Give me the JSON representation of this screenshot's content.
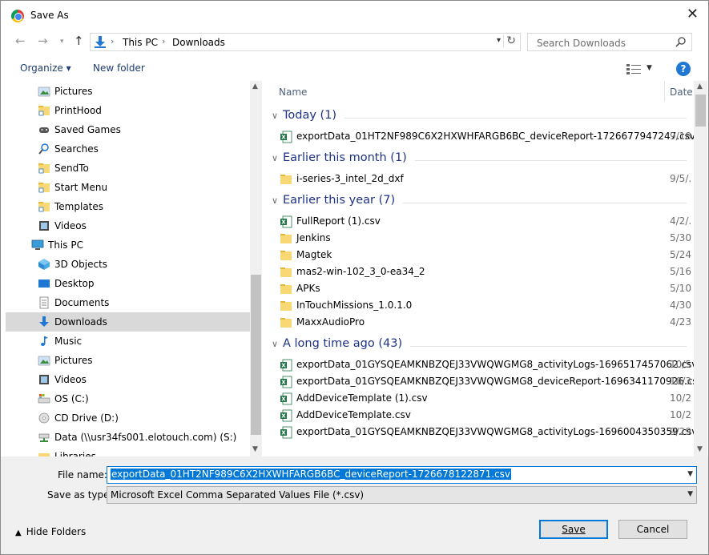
{
  "window": {
    "title": "Save As",
    "close_label": "✕"
  },
  "address": {
    "crumbs": [
      "This PC",
      "Downloads"
    ],
    "search_placeholder": "Search Downloads"
  },
  "toolbar": {
    "organize_label": "Organize ▾",
    "new_folder_label": "New folder",
    "help_label": "?"
  },
  "nav_pane": {
    "items": [
      {
        "label": "Pictures",
        "icon": "pictures-folder-icon"
      },
      {
        "label": "PrintHood",
        "icon": "shortcut-folder-icon"
      },
      {
        "label": "Saved Games",
        "icon": "saved-games-icon"
      },
      {
        "label": "Searches",
        "icon": "searches-icon"
      },
      {
        "label": "SendTo",
        "icon": "shortcut-folder-icon"
      },
      {
        "label": "Start Menu",
        "icon": "shortcut-folder-icon"
      },
      {
        "label": "Templates",
        "icon": "shortcut-folder-icon"
      },
      {
        "label": "Videos",
        "icon": "videos-folder-icon"
      },
      {
        "label": "This PC",
        "icon": "this-pc-icon"
      },
      {
        "label": "3D Objects",
        "icon": "3d-objects-icon"
      },
      {
        "label": "Desktop",
        "icon": "desktop-icon"
      },
      {
        "label": "Documents",
        "icon": "documents-icon"
      },
      {
        "label": "Downloads",
        "icon": "downloads-icon",
        "selected": true
      },
      {
        "label": "Music",
        "icon": "music-icon"
      },
      {
        "label": "Pictures",
        "icon": "pictures-folder-icon"
      },
      {
        "label": "Videos",
        "icon": "videos-folder-icon"
      },
      {
        "label": "OS (C:)",
        "icon": "os-drive-icon"
      },
      {
        "label": "CD Drive (D:)",
        "icon": "cd-drive-icon"
      },
      {
        "label": "Data (\\\\usr34fs001.elotouch.com) (S:)",
        "icon": "network-drive-icon"
      },
      {
        "label": "Libraries",
        "icon": "libraries-icon"
      }
    ]
  },
  "file_pane": {
    "columns": {
      "name": "Name",
      "date": "Date"
    },
    "groups": [
      {
        "title": "Today (1)",
        "files": [
          {
            "name": "exportData_01HT2NF989C6X2HXWHFARGB6BC_deviceReport-1726677947247.csv",
            "date": "9/18",
            "type": "csv"
          }
        ]
      },
      {
        "title": "Earlier this month (1)",
        "files": [
          {
            "name": "i-series-3_intel_2d_dxf",
            "date": "9/5/.",
            "type": "folder"
          }
        ]
      },
      {
        "title": "Earlier this year (7)",
        "files": [
          {
            "name": "FullReport (1).csv",
            "date": "4/2/.",
            "type": "csv"
          },
          {
            "name": "Jenkins",
            "date": "5/30",
            "type": "folder"
          },
          {
            "name": "Magtek",
            "date": "5/24",
            "type": "folder"
          },
          {
            "name": "mas2-win-102_3_0-ea34_2",
            "date": "5/16",
            "type": "folder"
          },
          {
            "name": "APKs",
            "date": "5/10",
            "type": "folder"
          },
          {
            "name": "InTouchMissions_1.0.1.0",
            "date": "4/30",
            "type": "folder"
          },
          {
            "name": "MaxxAudioPro",
            "date": "4/23",
            "type": "folder"
          }
        ]
      },
      {
        "title": "A long time ago (43)",
        "files": [
          {
            "name": "exportData_01GYSQEAMKNBZQEJ33VWQWGMG8_activityLogs-1696517457062.csv",
            "date": "10/5",
            "type": "csv"
          },
          {
            "name": "exportData_01GYSQEAMKNBZQEJ33VWQWGMG8_deviceReport-1696341170926.csv",
            "date": "10/3",
            "type": "csv"
          },
          {
            "name": "AddDeviceTemplate (1).csv",
            "date": "10/2",
            "type": "csv"
          },
          {
            "name": "AddDeviceTemplate.csv",
            "date": "10/2",
            "type": "csv"
          },
          {
            "name": "exportData_01GYSQEAMKNBZQEJ33VWQWGMG8_activityLogs-1696004350359.csv",
            "date": "9/29",
            "type": "csv"
          }
        ]
      }
    ]
  },
  "bottom": {
    "file_name_label": "File name:",
    "file_name_value": "exportData_01HT2NF989C6X2HXWHFARGB6BC_deviceReport-1726678122871.csv",
    "save_type_label": "Save as type:",
    "save_type_value": "Microsoft Excel Comma Separated Values File (*.csv)",
    "hide_folders_label": "Hide Folders",
    "save_label": "Save",
    "cancel_label": "Cancel"
  },
  "colors": {
    "accent": "#0078d7",
    "group_title": "#1e3287",
    "selected_bg": "#d9d9d9",
    "link": "#1e3c6e"
  }
}
